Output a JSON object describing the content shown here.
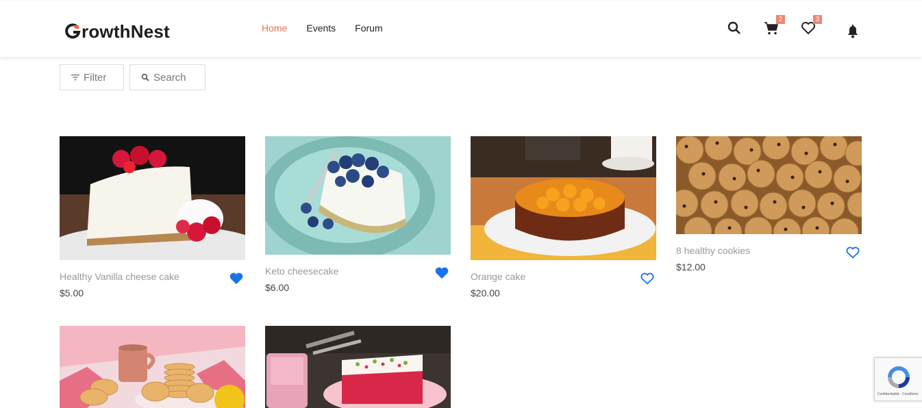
{
  "brand": {
    "name": "rowthNest",
    "accent": "#f26b4f"
  },
  "nav": [
    {
      "label": "Home",
      "active": true
    },
    {
      "label": "Events",
      "active": false
    },
    {
      "label": "Forum",
      "active": false
    }
  ],
  "header_icons": {
    "search": "search-icon",
    "cart": {
      "icon": "cart-icon",
      "count": "2"
    },
    "wishlist": {
      "icon": "heart-icon",
      "count": "3"
    },
    "notifications": "bell-icon"
  },
  "toolbar": {
    "filter_label": "Filter",
    "search_label": "Search"
  },
  "products": [
    {
      "name": "Healthy Vanilla cheese cake",
      "price": "$5.00",
      "favorited": true
    },
    {
      "name": "Keto cheesecake",
      "price": "$6.00",
      "favorited": true
    },
    {
      "name": "Orange cake",
      "price": "$20.00",
      "favorited": false
    },
    {
      "name": "8 healthy cookies",
      "price": "$12.00",
      "favorited": false
    }
  ],
  "products_row2": [
    {
      "image": "tea-and-biscuits"
    },
    {
      "image": "pink-cake-with-milkshake"
    }
  ],
  "recaptcha": {
    "text": "Confidentialité - Conditions"
  },
  "colors": {
    "heart": "#1a73e8",
    "price": "#444444",
    "name": "#999999"
  }
}
